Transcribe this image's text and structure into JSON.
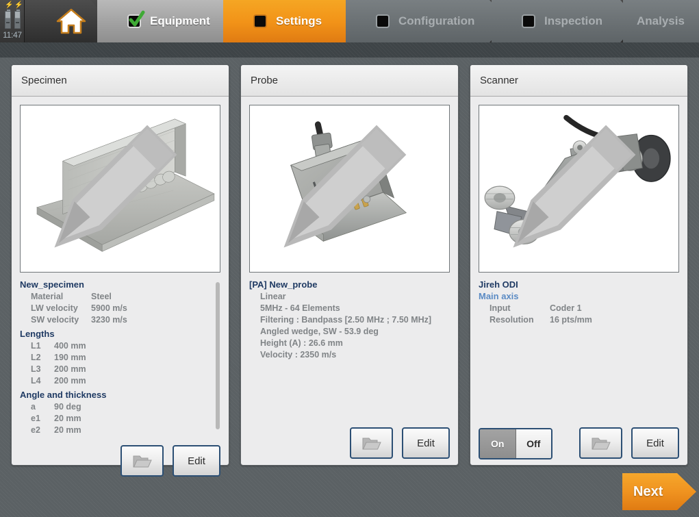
{
  "statusbar": {
    "battery1_icon": "battery-charging-icon",
    "battery2_icon": "battery-charging-icon",
    "clock": "11:47"
  },
  "nav": {
    "home_icon": "home-icon",
    "tabs": [
      {
        "label": "Equipment",
        "state": "completed",
        "icon": "checkbox-checked-icon"
      },
      {
        "label": "Settings",
        "state": "active",
        "icon": "checkbox-square-icon"
      },
      {
        "label": "Configuration",
        "state": "disabled",
        "icon": "checkbox-square-icon"
      },
      {
        "label": "Inspection",
        "state": "disabled",
        "icon": "checkbox-square-icon"
      },
      {
        "label": "Analysis",
        "state": "disabled",
        "icon": ""
      }
    ]
  },
  "panels": {
    "specimen": {
      "title": "Specimen",
      "photo_alt": "fillet-weld-t-joint-specimen",
      "pencil_icon": "pencil-icon",
      "name": "New_specimen",
      "properties": [
        {
          "key": "Material",
          "value": "Steel"
        },
        {
          "key": "LW velocity",
          "value": "5900 m/s"
        },
        {
          "key": "SW velocity",
          "value": "3230 m/s"
        }
      ],
      "lengths_group": "Lengths",
      "lengths": [
        {
          "key": "L1",
          "value": "400 mm"
        },
        {
          "key": "L2",
          "value": "190 mm"
        },
        {
          "key": "L3",
          "value": "200 mm"
        },
        {
          "key": "L4",
          "value": "200 mm"
        }
      ],
      "angle_group": "Angle and thickness",
      "angles": [
        {
          "key": "a",
          "value": "90 deg"
        },
        {
          "key": "e1",
          "value": "20 mm"
        },
        {
          "key": "e2",
          "value": "20 mm"
        }
      ],
      "open_label": "",
      "open_icon": "folder-open-icon",
      "edit_label": "Edit"
    },
    "probe": {
      "title": "Probe",
      "photo_alt": "phased-array-linear-probe-on-wedge",
      "pencil_icon": "pencil-icon",
      "name": "[PA] New_probe",
      "lines": [
        "Linear",
        "5MHz - 64 Elements",
        "Filtering : Bandpass [2.50 MHz ; 7.50 MHz]",
        "Angled wedge, SW - 53.9 deg",
        "Height (A) : 26.6 mm",
        "Velocity : 2350 m/s"
      ],
      "open_icon": "folder-open-icon",
      "edit_label": "Edit"
    },
    "scanner": {
      "title": "Scanner",
      "photo_alt": "jireh-odi-scanner-arm",
      "pencil_icon": "pencil-icon",
      "name": "Jireh ODI",
      "axis_label": "Main axis",
      "properties": [
        {
          "key": "Input",
          "value": "Coder 1"
        },
        {
          "key": "Resolution",
          "value": "16 pts/mm"
        }
      ],
      "toggle": {
        "on_label": "On",
        "off_label": "Off",
        "selected": "On"
      },
      "open_icon": "folder-open-icon",
      "edit_label": "Edit"
    }
  },
  "footer": {
    "next_label": "Next"
  },
  "colors": {
    "accent_orange": "#f09320",
    "heading_blue": "#1f3a63",
    "subheading_blue": "#5b8bc4",
    "value_gray": "#808487",
    "button_border": "#2c4f74",
    "background": "#5b6164"
  }
}
